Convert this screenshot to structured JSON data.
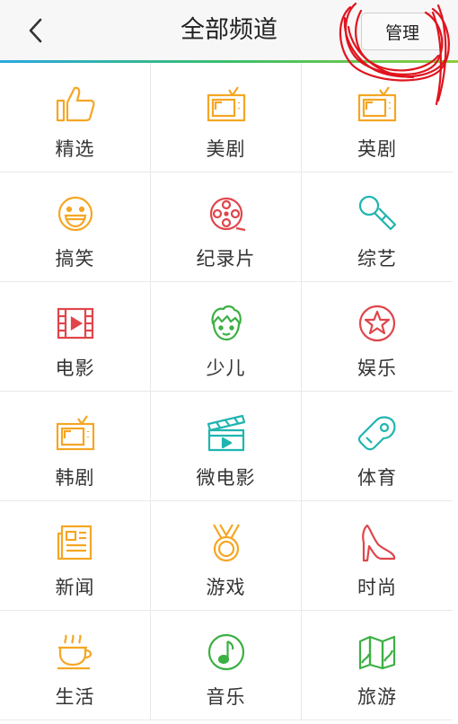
{
  "header": {
    "back_icon": "chevron-left-icon",
    "title": "全部频道",
    "manage_label": "管理"
  },
  "colors": {
    "orange": "#f5a623",
    "red": "#e0454b",
    "teal": "#1fb5b0",
    "green": "#3cb043",
    "accent_line": "#2aa7e0",
    "annotation": "#e0141e"
  },
  "channels": [
    {
      "label": "精选",
      "icon": "thumbs-up-icon"
    },
    {
      "label": "美剧",
      "icon": "tv-icon"
    },
    {
      "label": "英剧",
      "icon": "tv-icon"
    },
    {
      "label": "搞笑",
      "icon": "smiley-icon"
    },
    {
      "label": "纪录片",
      "icon": "film-reel-icon"
    },
    {
      "label": "综艺",
      "icon": "microphone-icon"
    },
    {
      "label": "电影",
      "icon": "film-play-icon"
    },
    {
      "label": "少儿",
      "icon": "boy-face-icon"
    },
    {
      "label": "娱乐",
      "icon": "star-circle-icon"
    },
    {
      "label": "韩剧",
      "icon": "tv-icon"
    },
    {
      "label": "微电影",
      "icon": "clapperboard-icon"
    },
    {
      "label": "体育",
      "icon": "whistle-icon"
    },
    {
      "label": "新闻",
      "icon": "newspaper-icon"
    },
    {
      "label": "游戏",
      "icon": "medal-icon"
    },
    {
      "label": "时尚",
      "icon": "high-heel-icon"
    },
    {
      "label": "生活",
      "icon": "coffee-cup-icon"
    },
    {
      "label": "音乐",
      "icon": "music-note-icon"
    },
    {
      "label": "旅游",
      "icon": "map-icon"
    }
  ]
}
